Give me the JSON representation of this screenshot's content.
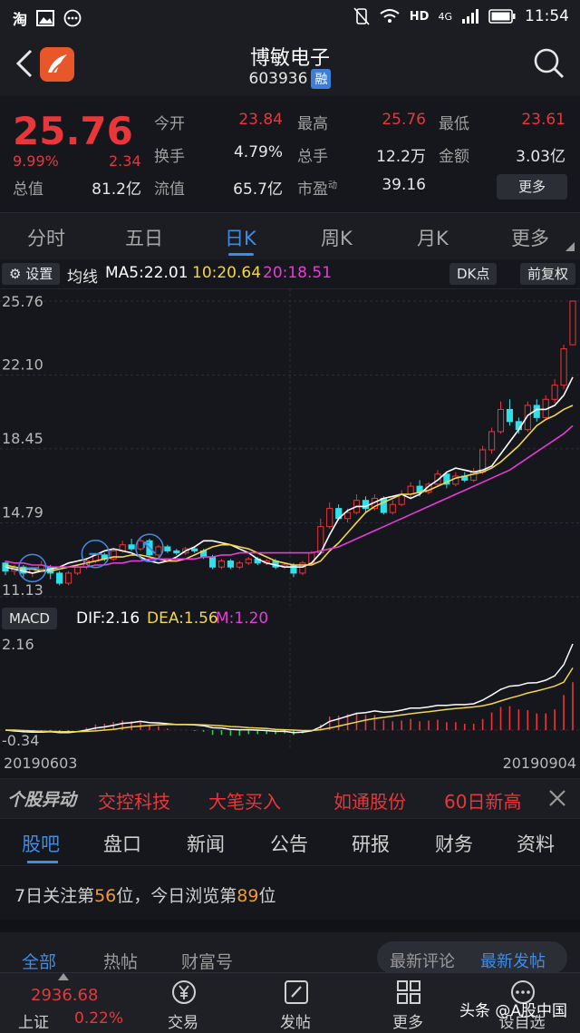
{
  "status_bar": {
    "app_glyph": "淘",
    "time": "11:54",
    "network": "4G"
  },
  "header": {
    "stock_name": "博敏电子",
    "stock_code": "603936",
    "badge": "融"
  },
  "quote": {
    "price": "25.76",
    "change_pct": "9.99%",
    "change": "2.34",
    "fields": [
      {
        "label": "今开",
        "value": "23.84",
        "color": "red"
      },
      {
        "label": "最高",
        "value": "25.76",
        "color": "red"
      },
      {
        "label": "最低",
        "value": "23.61",
        "color": "red"
      },
      {
        "label": "换手",
        "value": "4.79%",
        "color": "white"
      },
      {
        "label": "总手",
        "value": "12.2万",
        "color": "white"
      },
      {
        "label": "金额",
        "value": "3.03亿",
        "color": "white"
      },
      {
        "label": "总值",
        "value": "81.2亿",
        "color": "white"
      },
      {
        "label": "流值",
        "value": "65.7亿",
        "color": "white"
      },
      {
        "label": "市盈",
        "value": "39.16",
        "color": "white"
      }
    ],
    "pe_superscript": "动",
    "more_label": "更多"
  },
  "period_tabs": [
    "分时",
    "五日",
    "日K",
    "周K",
    "月K",
    "更多"
  ],
  "active_period": "日K",
  "chart_bar": {
    "settings": "设置",
    "ma_title": "均线",
    "ma5": "MA5:22.01",
    "ma10": "10:20.64",
    "ma20": "20:18.51",
    "dk": "DK点",
    "adjust": "前复权"
  },
  "colors": {
    "up": "#e8363b",
    "down": "#2ee0e8",
    "ma5": "#ffffff",
    "ma10": "#f2d64b",
    "ma20": "#e63bd6",
    "accent": "#3c8ce8"
  },
  "macd_bar": {
    "label": "MACD",
    "dif": "DIF:2.16",
    "dea": "DEA:1.56",
    "m": "M:1.20"
  },
  "chart_data": [
    {
      "type": "candlestick",
      "y_ticks": [
        "25.76",
        "22.10",
        "18.45",
        "14.79",
        "11.13"
      ],
      "ylim": [
        11.13,
        25.76
      ],
      "x_start": "20190603",
      "x_end": "20190904",
      "series": [
        {
          "name": "MA5",
          "values": [
            12.6,
            12.5,
            12.4,
            12.3,
            12.4,
            12.5,
            12.6,
            12.8,
            12.9,
            13.0,
            13.2,
            13.4,
            13.5,
            13.4,
            13.3,
            13.1,
            12.9,
            12.8,
            12.9,
            13.1,
            13.4,
            13.6,
            13.9,
            13.9,
            13.8,
            13.7,
            13.5,
            13.3,
            13.0,
            12.8,
            12.7,
            12.6,
            12.6,
            12.6,
            12.8,
            13.3,
            14.2,
            15.0,
            15.4,
            15.6,
            15.6,
            15.8,
            16.0,
            16.1,
            16.2,
            16.0,
            16.2,
            16.6,
            16.9,
            17.3,
            17.5,
            17.4,
            17.3,
            17.4,
            17.6,
            18.2,
            18.8,
            19.4,
            20.1,
            20.4,
            20.4,
            20.6,
            21.1,
            22.0
          ]
        },
        {
          "name": "MA10",
          "values": [
            12.7,
            12.6,
            12.5,
            12.5,
            12.4,
            12.4,
            12.5,
            12.6,
            12.7,
            12.8,
            12.9,
            13.0,
            13.1,
            13.1,
            13.2,
            13.2,
            13.1,
            13.0,
            12.9,
            12.9,
            13.0,
            13.2,
            13.4,
            13.6,
            13.7,
            13.7,
            13.6,
            13.5,
            13.3,
            13.1,
            12.9,
            12.8,
            12.7,
            12.7,
            12.7,
            12.9,
            13.4,
            13.8,
            14.3,
            14.8,
            15.3,
            15.6,
            15.8,
            16.0,
            16.2,
            16.2,
            16.3,
            16.4,
            16.6,
            16.8,
            17.0,
            17.1,
            17.2,
            17.3,
            17.5,
            17.8,
            18.2,
            18.6,
            19.1,
            19.6,
            19.9,
            20.1,
            20.4,
            20.6
          ]
        },
        {
          "name": "MA20",
          "values": [
            12.9,
            12.8,
            12.8,
            12.7,
            12.7,
            12.6,
            12.6,
            12.6,
            12.6,
            12.6,
            12.7,
            12.7,
            12.8,
            12.8,
            12.9,
            12.9,
            13.0,
            13.0,
            13.0,
            13.0,
            13.0,
            13.0,
            13.1,
            13.1,
            13.2,
            13.2,
            13.3,
            13.3,
            13.3,
            13.3,
            13.3,
            13.3,
            13.3,
            13.3,
            13.3,
            13.4,
            13.5,
            13.6,
            13.8,
            14.0,
            14.2,
            14.4,
            14.6,
            14.8,
            15.0,
            15.2,
            15.4,
            15.6,
            15.8,
            16.0,
            16.2,
            16.4,
            16.6,
            16.8,
            17.0,
            17.2,
            17.4,
            17.7,
            18.0,
            18.3,
            18.6,
            18.9,
            19.2,
            19.6
          ]
        }
      ],
      "candles": [
        [
          12.8,
          12.4,
          12.9,
          12.2
        ],
        [
          12.4,
          12.6,
          12.7,
          12.2
        ],
        [
          12.6,
          12.3,
          12.7,
          12.1
        ],
        [
          12.3,
          12.5,
          12.6,
          12.1
        ],
        [
          12.5,
          12.7,
          12.9,
          12.4
        ],
        [
          12.6,
          12.3,
          12.7,
          12.0
        ],
        [
          12.3,
          11.8,
          12.4,
          11.7
        ],
        [
          11.8,
          12.3,
          12.4,
          11.7
        ],
        [
          12.3,
          12.6,
          12.7,
          12.2
        ],
        [
          12.6,
          12.9,
          13.0,
          12.5
        ],
        [
          12.9,
          13.2,
          13.3,
          12.8
        ],
        [
          13.2,
          13.0,
          13.3,
          12.9
        ],
        [
          13.0,
          13.4,
          13.5,
          12.9
        ],
        [
          13.4,
          13.7,
          13.9,
          13.3
        ],
        [
          13.7,
          13.5,
          14.0,
          13.4
        ],
        [
          13.5,
          13.9,
          14.1,
          13.4
        ],
        [
          13.9,
          13.2,
          14.0,
          13.1
        ],
        [
          13.2,
          13.6,
          13.7,
          13.1
        ],
        [
          13.6,
          13.4,
          13.7,
          13.3
        ],
        [
          13.4,
          13.3,
          13.5,
          13.2
        ],
        [
          13.3,
          13.5,
          13.6,
          13.2
        ],
        [
          13.5,
          13.4,
          13.6,
          13.3
        ],
        [
          13.4,
          13.1,
          13.5,
          13.0
        ],
        [
          13.1,
          12.6,
          13.2,
          12.5
        ],
        [
          12.6,
          12.9,
          13.0,
          12.5
        ],
        [
          12.9,
          12.6,
          13.0,
          12.5
        ],
        [
          12.6,
          12.8,
          12.9,
          12.5
        ],
        [
          12.8,
          13.0,
          13.1,
          12.7
        ],
        [
          13.0,
          12.8,
          13.1,
          12.7
        ],
        [
          12.8,
          12.9,
          13.0,
          12.7
        ],
        [
          12.9,
          12.6,
          13.0,
          12.5
        ],
        [
          12.6,
          12.7,
          12.8,
          12.5
        ],
        [
          12.7,
          12.3,
          12.8,
          12.1
        ],
        [
          12.3,
          12.8,
          12.9,
          12.2
        ],
        [
          12.8,
          13.3,
          13.4,
          12.7
        ],
        [
          13.3,
          14.6,
          15.0,
          13.2
        ],
        [
          14.6,
          15.5,
          15.8,
          14.5
        ],
        [
          15.5,
          15.0,
          15.7,
          14.9
        ],
        [
          15.0,
          15.3,
          15.5,
          14.8
        ],
        [
          15.3,
          15.9,
          16.2,
          15.2
        ],
        [
          15.9,
          15.5,
          16.1,
          15.3
        ],
        [
          15.5,
          16.0,
          16.2,
          15.4
        ],
        [
          16.0,
          15.3,
          16.1,
          15.2
        ],
        [
          15.3,
          15.7,
          15.9,
          15.2
        ],
        [
          15.7,
          16.2,
          16.4,
          15.6
        ],
        [
          16.2,
          16.6,
          16.8,
          16.0
        ],
        [
          16.6,
          16.3,
          16.9,
          16.1
        ],
        [
          16.3,
          16.7,
          16.8,
          16.2
        ],
        [
          16.7,
          17.2,
          17.4,
          16.6
        ],
        [
          17.2,
          16.7,
          17.3,
          16.5
        ],
        [
          16.7,
          17.1,
          17.3,
          16.6
        ],
        [
          17.1,
          16.9,
          17.3,
          16.8
        ],
        [
          16.9,
          17.3,
          17.5,
          16.8
        ],
        [
          17.3,
          18.4,
          18.6,
          17.2
        ],
        [
          18.4,
          19.3,
          19.5,
          18.2
        ],
        [
          19.3,
          20.4,
          20.8,
          19.2
        ],
        [
          20.4,
          19.8,
          20.9,
          19.6
        ],
        [
          19.8,
          19.4,
          20.0,
          19.2
        ],
        [
          19.4,
          20.6,
          20.8,
          19.3
        ],
        [
          20.6,
          20.0,
          20.9,
          19.8
        ],
        [
          20.0,
          20.9,
          21.1,
          19.9
        ],
        [
          20.9,
          21.6,
          21.9,
          20.7
        ],
        [
          21.6,
          23.4,
          23.6,
          21.4
        ],
        [
          23.6,
          25.76,
          25.76,
          23.6
        ]
      ]
    },
    {
      "type": "bar",
      "title": "MACD",
      "y_ticks": [
        "2.16",
        "-0.34"
      ],
      "ylim": [
        -0.34,
        2.16
      ],
      "series": [
        {
          "name": "DIF",
          "values": [
            0.0,
            -0.02,
            -0.04,
            -0.05,
            -0.05,
            -0.04,
            -0.06,
            -0.06,
            -0.04,
            0.0,
            0.05,
            0.08,
            0.12,
            0.17,
            0.19,
            0.22,
            0.19,
            0.18,
            0.16,
            0.14,
            0.14,
            0.13,
            0.11,
            0.06,
            0.05,
            0.02,
            0.01,
            0.01,
            0.0,
            -0.01,
            -0.03,
            -0.03,
            -0.06,
            -0.05,
            -0.02,
            0.08,
            0.22,
            0.28,
            0.35,
            0.42,
            0.44,
            0.48,
            0.45,
            0.46,
            0.5,
            0.55,
            0.55,
            0.58,
            0.62,
            0.62,
            0.64,
            0.64,
            0.66,
            0.75,
            0.88,
            1.02,
            1.1,
            1.12,
            1.18,
            1.19,
            1.25,
            1.36,
            1.64,
            2.16
          ]
        },
        {
          "name": "DEA",
          "values": [
            0.0,
            0.0,
            -0.01,
            -0.02,
            -0.03,
            -0.03,
            -0.04,
            -0.04,
            -0.04,
            -0.03,
            -0.02,
            0.0,
            0.02,
            0.05,
            0.08,
            0.1,
            0.12,
            0.13,
            0.14,
            0.14,
            0.14,
            0.14,
            0.13,
            0.12,
            0.11,
            0.09,
            0.08,
            0.06,
            0.05,
            0.04,
            0.02,
            0.01,
            0.0,
            -0.01,
            -0.01,
            0.01,
            0.05,
            0.1,
            0.15,
            0.2,
            0.25,
            0.29,
            0.32,
            0.35,
            0.38,
            0.41,
            0.44,
            0.46,
            0.49,
            0.52,
            0.54,
            0.56,
            0.58,
            0.61,
            0.66,
            0.73,
            0.8,
            0.86,
            0.93,
            0.98,
            1.04,
            1.1,
            1.2,
            1.56
          ]
        },
        {
          "name": "M",
          "values": [
            0.0,
            -0.04,
            -0.06,
            -0.06,
            -0.04,
            -0.02,
            -0.04,
            -0.04,
            0.0,
            0.06,
            0.14,
            0.16,
            0.2,
            0.24,
            0.22,
            0.24,
            0.14,
            0.1,
            0.04,
            0.0,
            0.0,
            -0.02,
            -0.04,
            -0.12,
            -0.12,
            -0.14,
            -0.14,
            -0.1,
            -0.1,
            -0.1,
            -0.1,
            -0.08,
            -0.12,
            -0.08,
            -0.02,
            0.14,
            0.34,
            0.36,
            0.4,
            0.44,
            0.38,
            0.38,
            0.26,
            0.22,
            0.24,
            0.28,
            0.22,
            0.24,
            0.26,
            0.2,
            0.2,
            0.16,
            0.16,
            0.28,
            0.44,
            0.58,
            0.6,
            0.52,
            0.5,
            0.42,
            0.42,
            0.52,
            0.88,
            1.2
          ]
        }
      ]
    }
  ],
  "ticker": {
    "items": [
      "交控科技",
      "大笔买入",
      "如通股份",
      "60日新高"
    ]
  },
  "info_tabs": [
    "股吧",
    "盘口",
    "新闻",
    "公告",
    "研报",
    "财务",
    "资料"
  ],
  "rank_line": {
    "prefix": "7日关注第",
    "attention_rank": "56",
    "middle": "位，今日浏览第",
    "browse_rank": "89",
    "suffix": "位"
  },
  "feed_tabs": [
    "全部",
    "热帖",
    "财富号"
  ],
  "sort_options": [
    "最新评论",
    "最新发帖"
  ],
  "bottom_nav": {
    "index_value": "2936.68",
    "index_name": "上证",
    "index_change": "0.22%",
    "items": [
      "交易",
      "发帖",
      "更多",
      "设自选"
    ]
  },
  "watermark": "头条 @A股中国"
}
